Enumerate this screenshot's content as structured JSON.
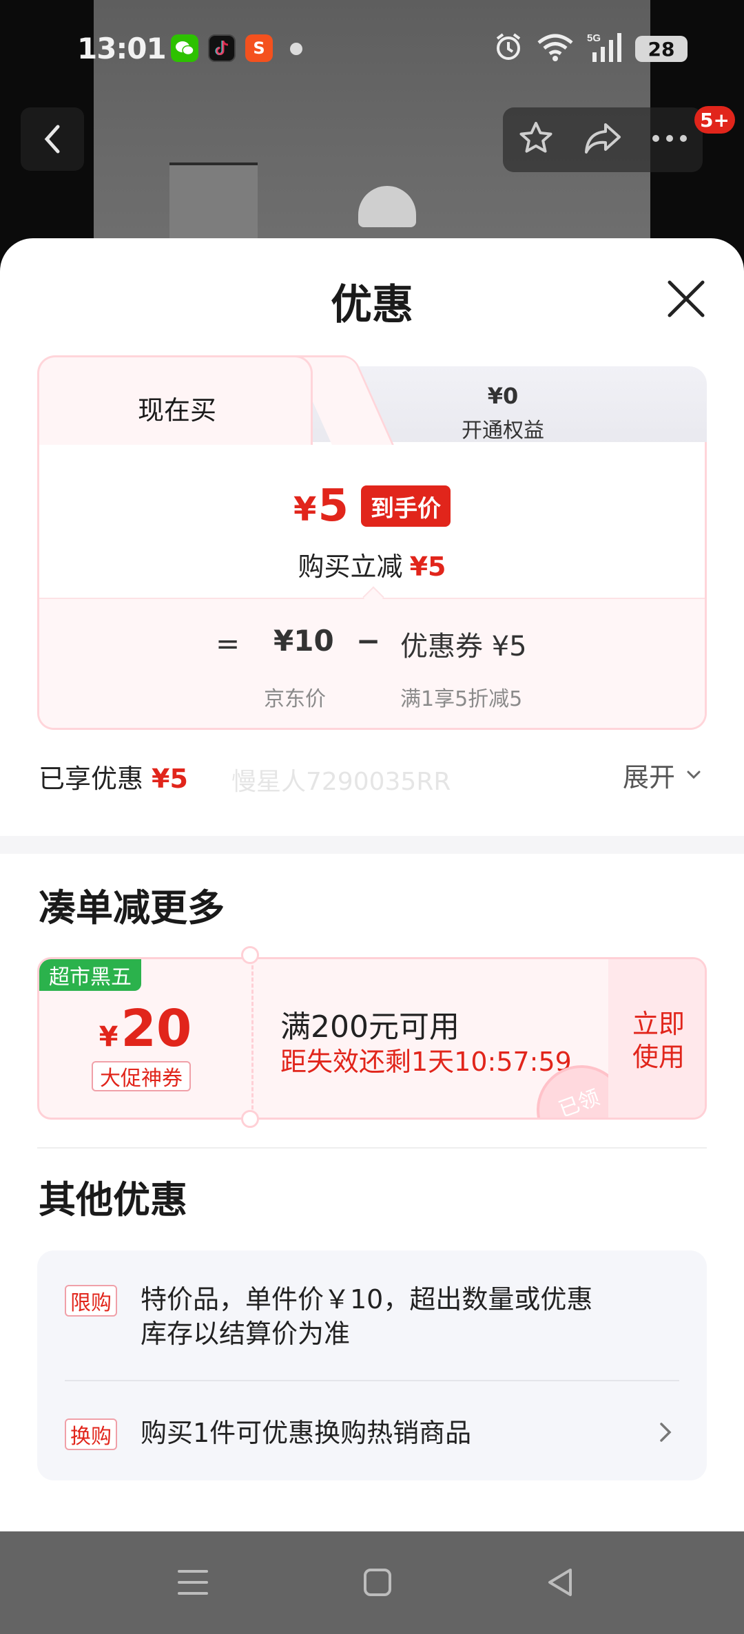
{
  "status_bar": {
    "time": "13:01",
    "battery": "28",
    "network": "5G"
  },
  "top_bar": {
    "notification_badge": "5+"
  },
  "sheet": {
    "title": "优惠"
  },
  "tabs": {
    "now_label": "现在买",
    "other_price": "¥0",
    "other_label": "开通权益"
  },
  "final_price": {
    "currency": "¥",
    "amount": "5",
    "tag": "到手价",
    "save_prefix": "购买立减",
    "save_amount": "¥5"
  },
  "breakdown": {
    "equals": "=",
    "jd_price": "¥10",
    "minus": "−",
    "coupon": "优惠券 ¥5",
    "jd_price_label": "京东价",
    "coupon_label": "满1享5折减5"
  },
  "summary": {
    "enjoyed_label": "已享优惠",
    "enjoyed_amount": "¥5",
    "watermark": "慢星人7290035RR",
    "expand_label": "展开"
  },
  "more_section": {
    "title": "凑单减更多"
  },
  "coupon": {
    "tag": "超市黑五",
    "currency": "¥",
    "amount": "20",
    "subtitle": "大促神券",
    "condition": "满200元可用",
    "timer": "距失效还剩1天10:57:59",
    "use_label": "立即使用",
    "stamp": "已领"
  },
  "other_section": {
    "title": "其他优惠",
    "items": [
      {
        "tag": "限购",
        "text_line1": "特价品，单件价￥10，超出数量或优惠",
        "text_line2": "库存以结算价为准"
      },
      {
        "tag": "换购",
        "text_line1": "购买1件可优惠换购热销商品"
      }
    ]
  },
  "colors": {
    "accent_red": "#e1251b",
    "coupon_green": "#2bb24c",
    "card_pink": "#fff5f6"
  }
}
